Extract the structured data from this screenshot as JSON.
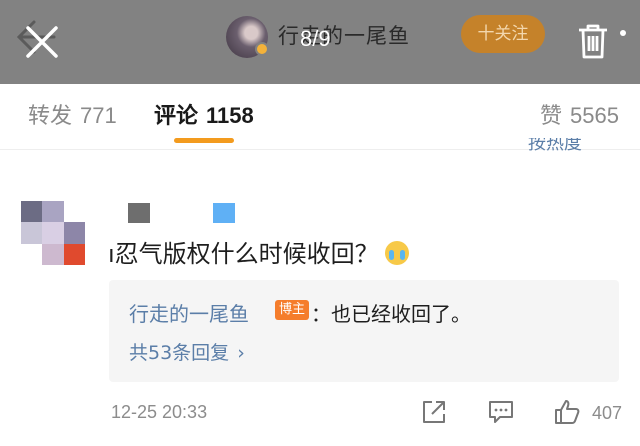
{
  "header": {
    "author_name": "行走的一尾鱼",
    "page_counter": "8/9",
    "follow_label": "十关注"
  },
  "tabs": [
    {
      "label": "转发",
      "count": "771",
      "active": false
    },
    {
      "label": "评论",
      "count": "1158",
      "active": true
    },
    {
      "label": "赞",
      "count": "5565",
      "active": false
    }
  ],
  "sort_link": "按热度",
  "comment": {
    "text": "ı忍气版权什么时候收回？",
    "emoji": "crying-face",
    "reply": {
      "author": "行走的一尾鱼",
      "badge": "博主",
      "text": "：也已经收回了。",
      "more_label": "共53条回复",
      "more_chevron": "›"
    },
    "timestamp": "12-25 20:33",
    "like_count": "407"
  },
  "colors": {
    "accent_orange": "#f39b1e",
    "link_blue": "#5b7ea8",
    "op_badge": "#f57d2c",
    "overlay_gray": "#828282"
  },
  "icons": [
    "back-arrow-icon",
    "close-icon",
    "trash-icon",
    "share-icon",
    "comment-icon",
    "like-icon"
  ]
}
